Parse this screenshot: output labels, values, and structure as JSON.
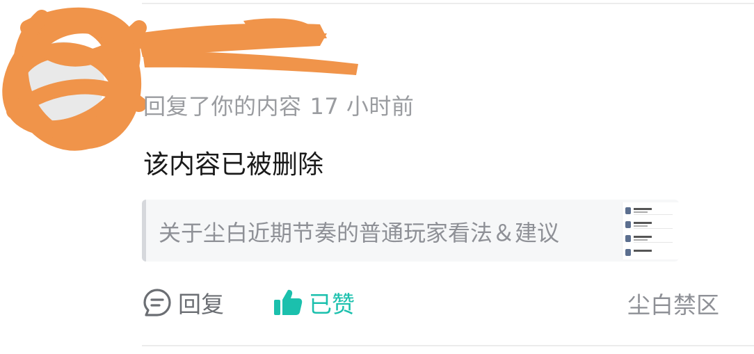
{
  "colors": {
    "accent_like": "#1bc0ad",
    "meta_text": "#9a9ca0",
    "redaction": "#f0944a"
  },
  "notification": {
    "user": {
      "avatar_icon": "avatar",
      "redacted": true
    },
    "action_text": "回复了你的内容",
    "time": "17 小时前",
    "content": "该内容已被删除",
    "quoted_post": {
      "title": "关于尘白近期节奏的普通玩家看法＆建议",
      "thumbnail_icon": "post-thumbnail"
    },
    "actions": {
      "reply_label": "回复",
      "reply_icon": "comment-icon",
      "like_label": "已赞",
      "like_icon": "thumbs-up-icon",
      "like_state": "liked"
    },
    "category": "尘白禁区"
  }
}
